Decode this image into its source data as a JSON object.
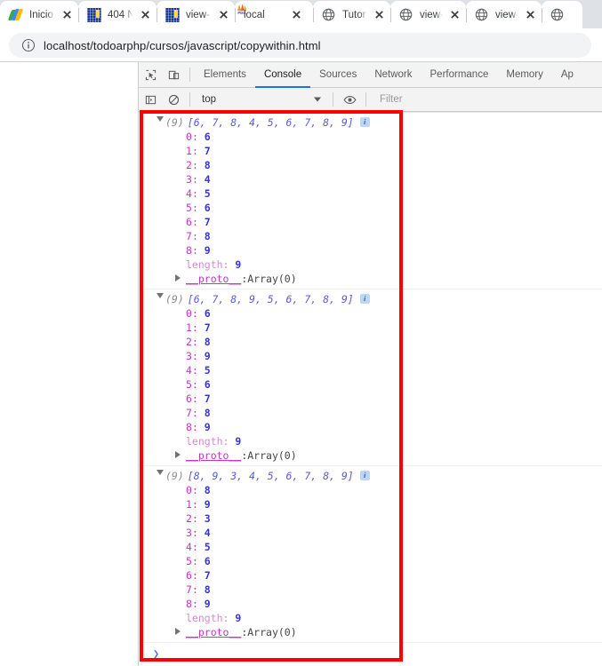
{
  "browser": {
    "tabs": [
      {
        "title": "Inicio",
        "favicon": "drive-icon",
        "close_label": "×"
      },
      {
        "title": "404 N",
        "favicon": "blue-page-icon",
        "close_label": "×"
      },
      {
        "title": "view-",
        "favicon": "blue-page-icon",
        "close_label": "×"
      },
      {
        "title": "local",
        "favicon": "phpmyadmin-icon",
        "close_label": "×"
      },
      {
        "title": "Tutor",
        "favicon": "globe-icon",
        "close_label": "×"
      },
      {
        "title": "view-",
        "favicon": "globe-icon",
        "close_label": "×"
      },
      {
        "title": "view-",
        "favicon": "globe-icon",
        "close_label": "×"
      },
      {
        "title": "",
        "favicon": "globe-icon",
        "close_label": "×"
      }
    ],
    "address_bar": {
      "url": "localhost/todoarphp/cursos/javascript/copywithin.html",
      "info_icon": "info-circle-icon"
    }
  },
  "devtools": {
    "inspect_icon": "inspect-element-icon",
    "device_icon": "device-toolbar-icon",
    "tabs": [
      {
        "label": "Elements",
        "active": false
      },
      {
        "label": "Console",
        "active": true
      },
      {
        "label": "Sources",
        "active": false
      },
      {
        "label": "Network",
        "active": false
      },
      {
        "label": "Performance",
        "active": false
      },
      {
        "label": "Memory",
        "active": false
      },
      {
        "label": "Ap",
        "active": false
      }
    ],
    "console_toolbar": {
      "sidebar_icon": "console-sidebar-icon",
      "clear_icon": "clear-console-icon",
      "context": "top",
      "eye_icon": "live-expression-icon",
      "filter_placeholder": "Filter"
    },
    "accent_color": "#1a73e8"
  },
  "console": {
    "length_key": "length",
    "proto_key": "__proto__",
    "proto_value": "Array(0)",
    "info_badge": "i",
    "prompt_caret": "❯",
    "messages": [
      {
        "count": "(9)",
        "preview": "[6, 7, 8, 4, 5, 6, 7, 8, 9]",
        "entries": [
          {
            "index": "0",
            "value": "6"
          },
          {
            "index": "1",
            "value": "7"
          },
          {
            "index": "2",
            "value": "8"
          },
          {
            "index": "3",
            "value": "4"
          },
          {
            "index": "4",
            "value": "5"
          },
          {
            "index": "5",
            "value": "6"
          },
          {
            "index": "6",
            "value": "7"
          },
          {
            "index": "7",
            "value": "8"
          },
          {
            "index": "8",
            "value": "9"
          }
        ],
        "length": "9"
      },
      {
        "count": "(9)",
        "preview": "[6, 7, 8, 9, 5, 6, 7, 8, 9]",
        "entries": [
          {
            "index": "0",
            "value": "6"
          },
          {
            "index": "1",
            "value": "7"
          },
          {
            "index": "2",
            "value": "8"
          },
          {
            "index": "3",
            "value": "9"
          },
          {
            "index": "4",
            "value": "5"
          },
          {
            "index": "5",
            "value": "6"
          },
          {
            "index": "6",
            "value": "7"
          },
          {
            "index": "7",
            "value": "8"
          },
          {
            "index": "8",
            "value": "9"
          }
        ],
        "length": "9"
      },
      {
        "count": "(9)",
        "preview": "[8, 9, 3, 4, 5, 6, 7, 8, 9]",
        "entries": [
          {
            "index": "0",
            "value": "8"
          },
          {
            "index": "1",
            "value": "9"
          },
          {
            "index": "2",
            "value": "3"
          },
          {
            "index": "3",
            "value": "4"
          },
          {
            "index": "4",
            "value": "5"
          },
          {
            "index": "5",
            "value": "6"
          },
          {
            "index": "6",
            "value": "7"
          },
          {
            "index": "7",
            "value": "8"
          },
          {
            "index": "8",
            "value": "9"
          }
        ],
        "length": "9"
      }
    ]
  },
  "annotation": {
    "highlight_color": "#ff0000"
  }
}
